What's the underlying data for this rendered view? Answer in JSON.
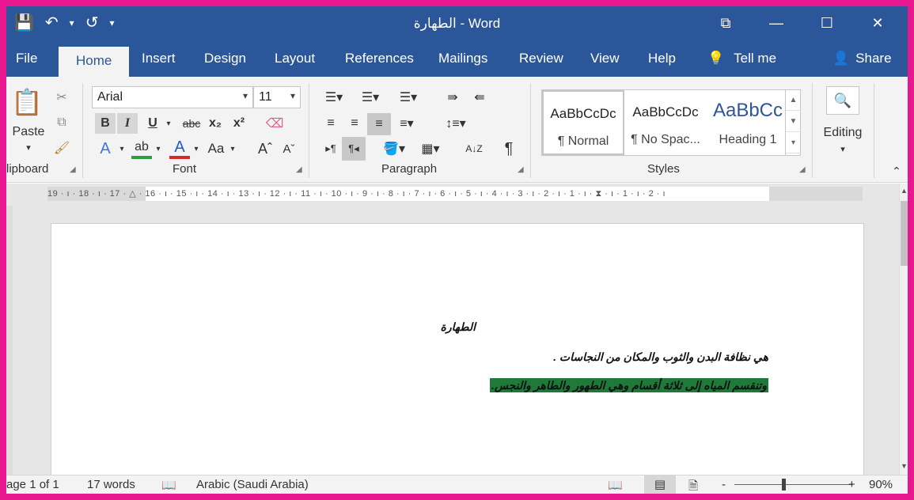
{
  "window": {
    "doc_name": "الطهارة",
    "separator": "-",
    "app_name": "Word",
    "quick_access": {
      "save_icon": "💾",
      "undo_icon": "↶",
      "undo_dd": "▾",
      "redo_icon": "↺",
      "customize_icon": "▾"
    },
    "controls": {
      "ribbon_display_icon": "⧉",
      "minimize_icon": "—",
      "maximize_icon": "☐",
      "close_icon": "✕"
    }
  },
  "tabs": [
    {
      "label": "File"
    },
    {
      "label": "Home"
    },
    {
      "label": "Insert"
    },
    {
      "label": "Design"
    },
    {
      "label": "Layout"
    },
    {
      "label": "References"
    },
    {
      "label": "Mailings"
    },
    {
      "label": "Review"
    },
    {
      "label": "View"
    },
    {
      "label": "Help"
    }
  ],
  "tell_me": {
    "icon": "💡",
    "label": "Tell me"
  },
  "share": {
    "icon": "👤",
    "label": "Share"
  },
  "ribbon": {
    "clipboard": {
      "label": "lipboard",
      "paste_label": "Paste",
      "paste_dd": "▾"
    },
    "font": {
      "label": "Font",
      "font_name": "Arial",
      "font_size": "11",
      "bold": "B",
      "italic": "I",
      "underline": "U",
      "strike": "abc",
      "subscript": "x₂",
      "superscript": "x²",
      "text_effects": "A",
      "highlight": "ab",
      "font_color": "A",
      "change_case": "Aa",
      "grow": "Aˆ",
      "shrink": "Aˇ"
    },
    "paragraph": {
      "label": "Paragraph",
      "sort": "A↓Z",
      "pilcrow": "¶"
    },
    "styles": {
      "label": "Styles",
      "items": [
        {
          "preview": "AaBbCcDc",
          "name": "¶ Normal"
        },
        {
          "preview": "AaBbCcDc",
          "name": "¶ No Spac..."
        },
        {
          "preview": "AaBbCc",
          "name": "Heading 1"
        }
      ],
      "scroll_up": "▲",
      "scroll_down": "▼",
      "more": "▾"
    },
    "editing": {
      "label": "Editing",
      "icon": "🔍",
      "dd": "▾"
    },
    "collapse_icon": "⌃"
  },
  "ruler": {
    "text": "19 · ı · 18 · ı · 17 · △ · 16 · ı · 15 · ı · 14 · ı · 13 · ı · 12 · ı · 11 · ı · 10 · ı · 9 · ı · 8 · ı · 7 · ı · 6 · ı · 5 · ı · 4 · ı · 3 · ı · 2 · ı · 1 · ı · ⧗ · ı · 1 · ı · 2 · ı"
  },
  "document": {
    "title": "الطهارة",
    "line1": "هي نظافة البدن والثوب والمكان من النجاسات .",
    "line2": "وتنقسم المياه إلى ثلاثة أقسام وهي الطهور والطاهر والنجس."
  },
  "status": {
    "page": "age 1 of 1",
    "words": "17 words",
    "proof_icon": "📖",
    "language": "Arabic (Saudi Arabia)",
    "read_mode_icon": "📖",
    "print_layout_icon": "▤",
    "web_layout_icon": "🗎",
    "zoom_minus": "-",
    "zoom_plus": "+",
    "zoom": "90%",
    "zoom_level": 0.9
  },
  "scroll": {
    "up": "▲",
    "down": "▼"
  }
}
